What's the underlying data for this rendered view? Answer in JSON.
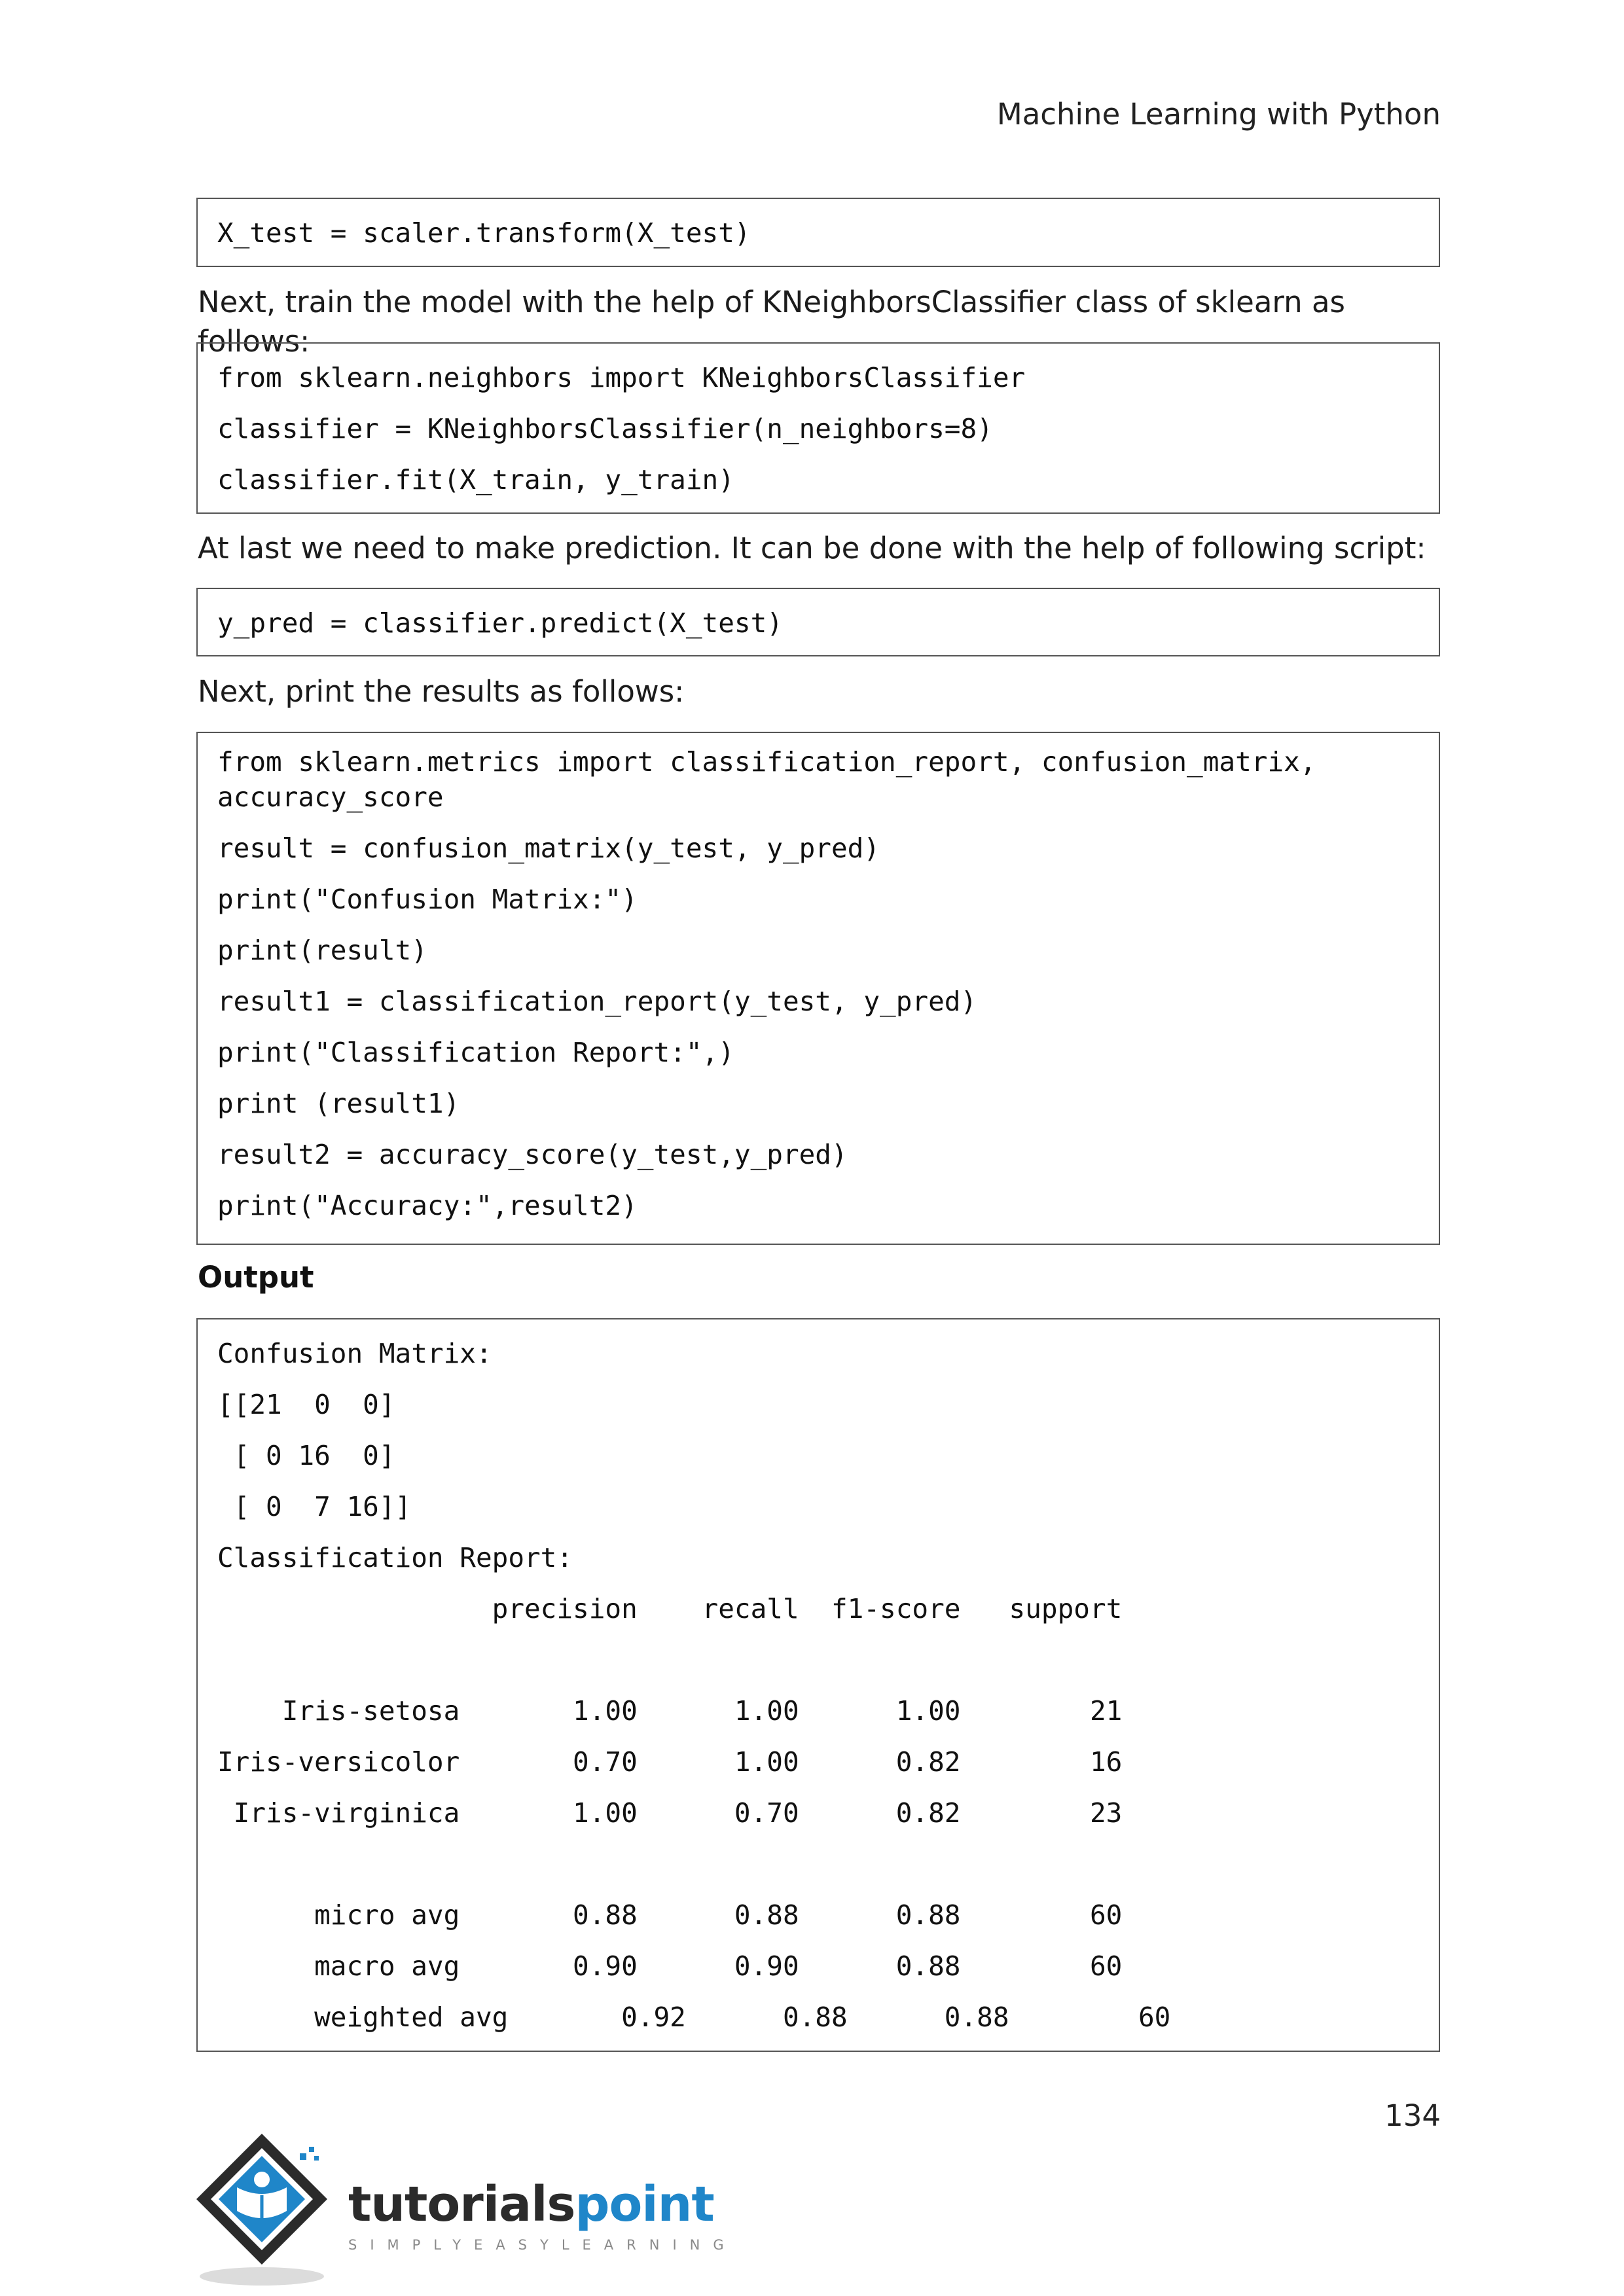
{
  "header": {
    "title": "Machine Learning with Python"
  },
  "blocks": {
    "code1": [
      "X_test = scaler.transform(X_test)"
    ],
    "text1": "Next, train the model with the help of KNeighborsClassifier class of sklearn as follows:",
    "code2": [
      "from sklearn.neighbors import KNeighborsClassifier",
      "classifier = KNeighborsClassifier(n_neighbors=8)",
      "classifier.fit(X_train, y_train)"
    ],
    "text2": "At last we need to make prediction. It can be done with the help of following script:",
    "code3": [
      "y_pred = classifier.predict(X_test)"
    ],
    "text3": "Next, print the results as follows:",
    "code4": [
      "from sklearn.metrics import classification_report, confusion_matrix,\naccuracy_score",
      "result = confusion_matrix(y_test, y_pred)",
      "print(\"Confusion Matrix:\")",
      "print(result)",
      "result1 = classification_report(y_test, y_pred)",
      "print(\"Classification Report:\",)",
      "print (result1)",
      "result2 = accuracy_score(y_test,y_pred)",
      "print(\"Accuracy:\",result2)"
    ],
    "output_heading": "Output",
    "output": [
      "Confusion Matrix:",
      "[[21  0  0]",
      " [ 0 16  0]",
      " [ 0  7 16]]",
      "Classification Report:",
      "                 precision    recall  f1-score   support",
      "",
      "    Iris-setosa       1.00      1.00      1.00        21",
      "Iris-versicolor       0.70      1.00      0.82        16",
      " Iris-virginica       1.00      0.70      0.82        23",
      "",
      "      micro avg       0.88      0.88      0.88        60",
      "      macro avg       0.90      0.90      0.88        60",
      "      weighted avg       0.92      0.88      0.88        60"
    ]
  },
  "footer": {
    "page_number": "134",
    "logo_word_dark": "tutorials",
    "logo_word_blue": "point",
    "logo_tagline": "SIMPLYEASYLEARNING"
  },
  "colors": {
    "logo_blue": "#1f86c9",
    "logo_dark": "#2b2b2b",
    "border": "#555555"
  }
}
